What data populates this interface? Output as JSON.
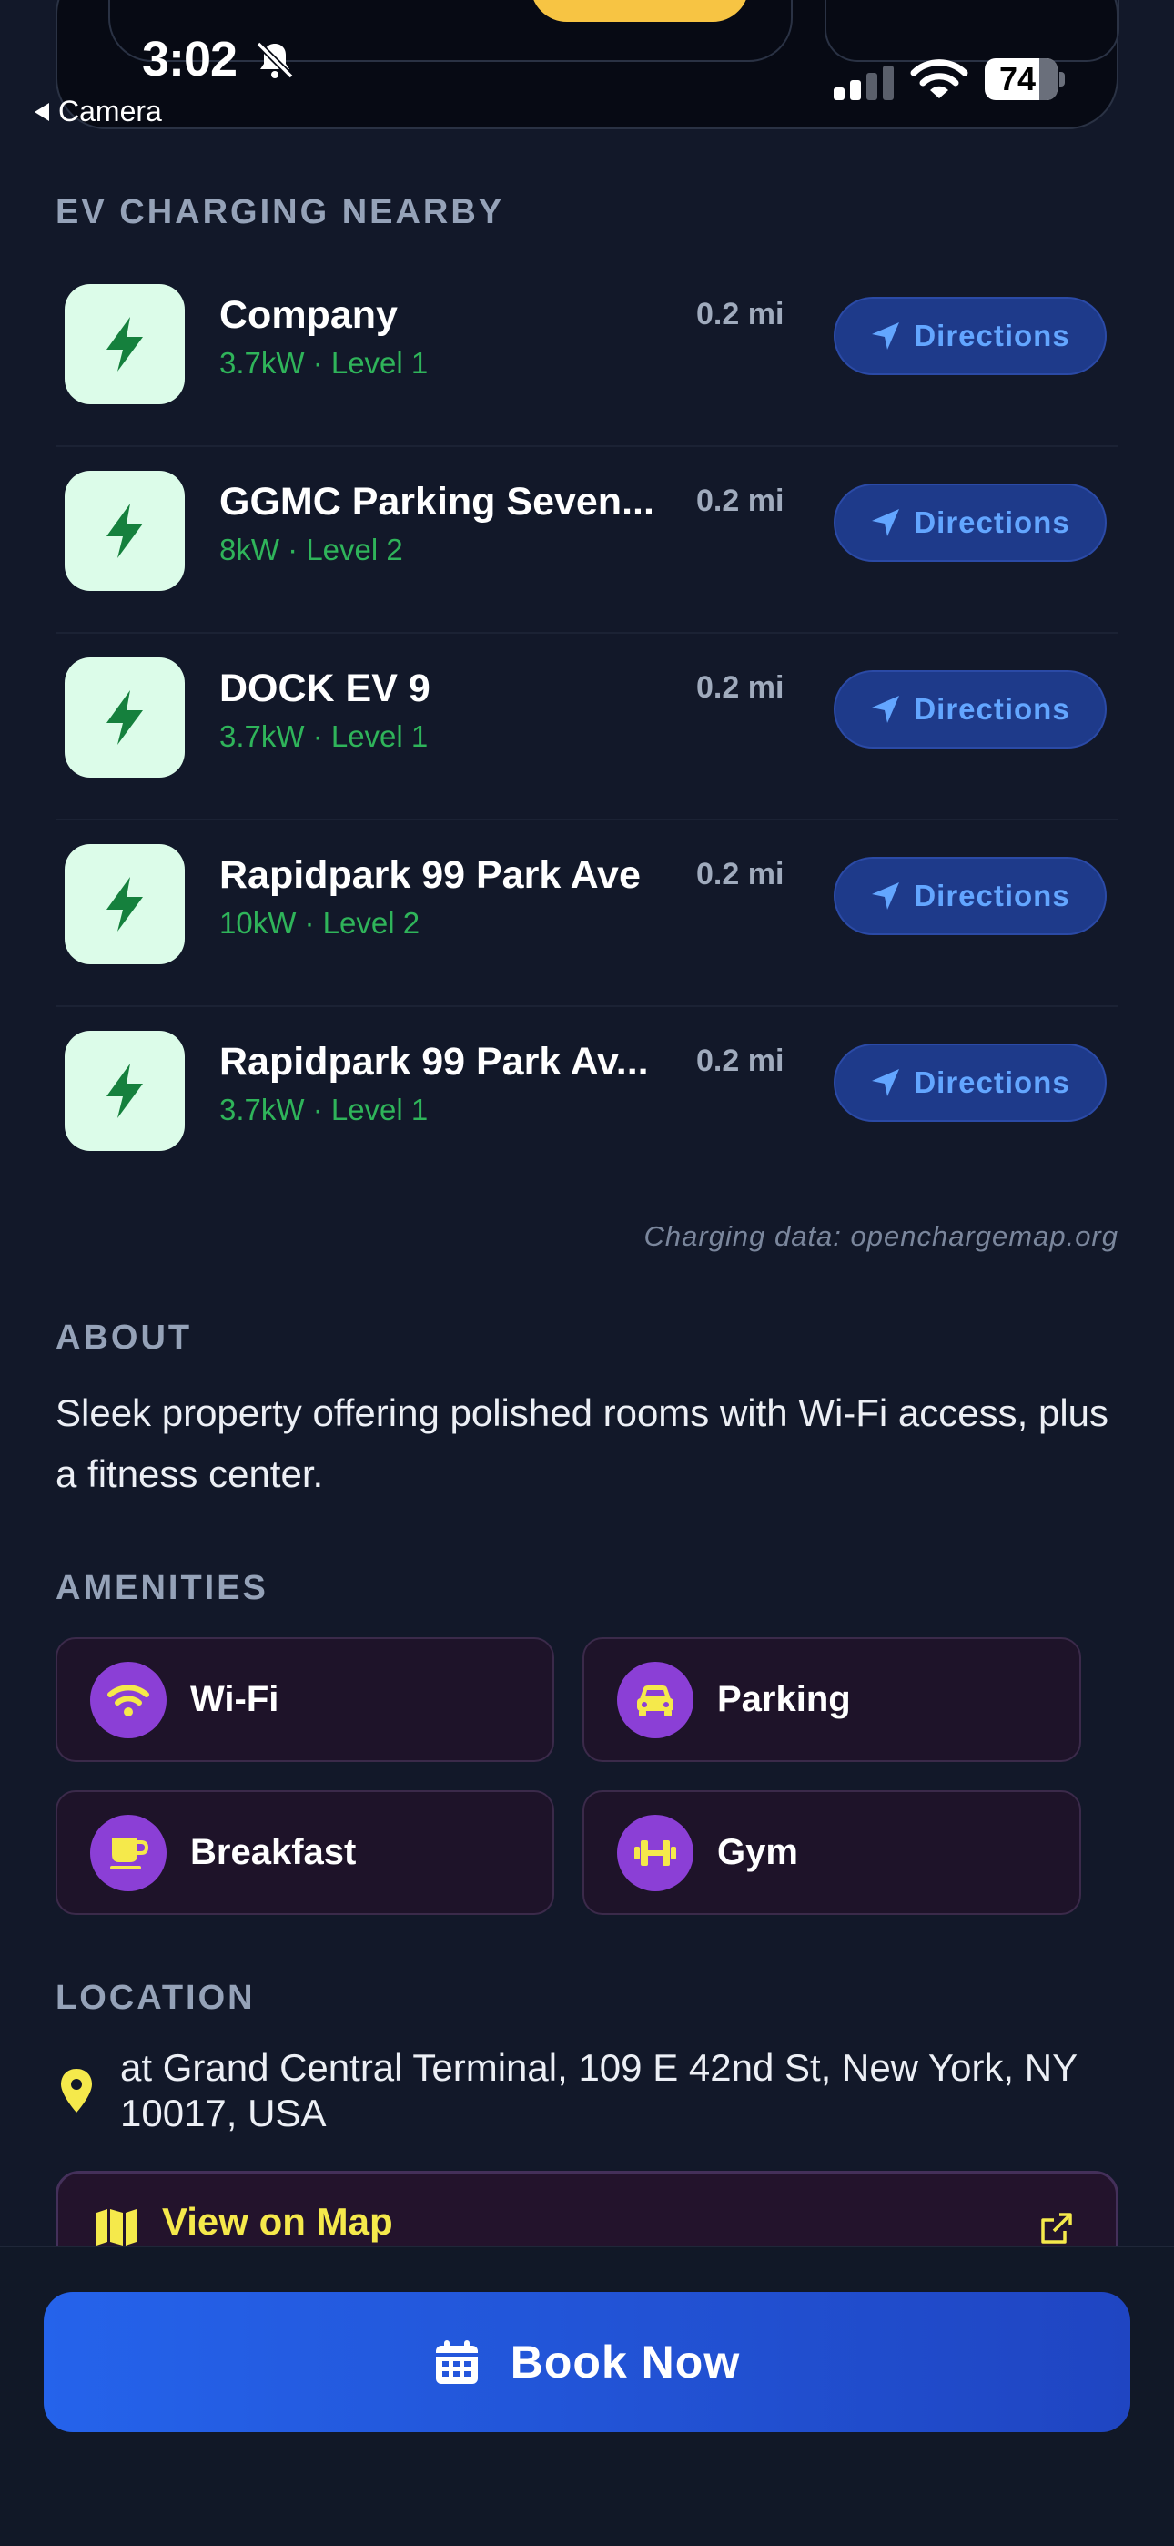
{
  "status_bar": {
    "time": "3:02",
    "back_label": "Camera",
    "battery": "74"
  },
  "ev_section": {
    "title": "EV CHARGING NEARBY",
    "chargers": [
      {
        "name": "Company",
        "spec": "3.7kW · Level 1",
        "distance": "0.2 mi",
        "action": "Directions"
      },
      {
        "name": "GGMC Parking Seven...",
        "spec": "8kW · Level 2",
        "distance": "0.2 mi",
        "action": "Directions"
      },
      {
        "name": "DOCK EV 9",
        "spec": "3.7kW · Level 1",
        "distance": "0.2 mi",
        "action": "Directions"
      },
      {
        "name": "Rapidpark 99 Park Ave",
        "spec": "10kW · Level 2",
        "distance": "0.2 mi",
        "action": "Directions"
      },
      {
        "name": "Rapidpark 99 Park Av...",
        "spec": "3.7kW · Level 1",
        "distance": "0.2 mi",
        "action": "Directions"
      }
    ],
    "credit": "Charging data: openchargemap.org"
  },
  "about": {
    "title": "ABOUT",
    "text": "Sleek property offering polished rooms with Wi-Fi access, plus a fitness center."
  },
  "amenities": {
    "title": "AMENITIES",
    "items": [
      {
        "label": "Wi-Fi",
        "icon": "wifi-icon"
      },
      {
        "label": "Parking",
        "icon": "car-icon"
      },
      {
        "label": "Breakfast",
        "icon": "coffee-icon"
      },
      {
        "label": "Gym",
        "icon": "dumbbell-icon"
      }
    ]
  },
  "location": {
    "title": "LOCATION",
    "address": "at Grand Central Terminal, 109 E 42nd St, New York, NY 10017, USA",
    "map_button": "View on Map"
  },
  "booking": {
    "button": "Book Now"
  },
  "colors": {
    "background": "#121829",
    "accent_blue": "#2563eb",
    "charger_green": "#2fb45a",
    "amenity_purple": "#8b3fd6",
    "map_yellow": "#f5e94b"
  }
}
